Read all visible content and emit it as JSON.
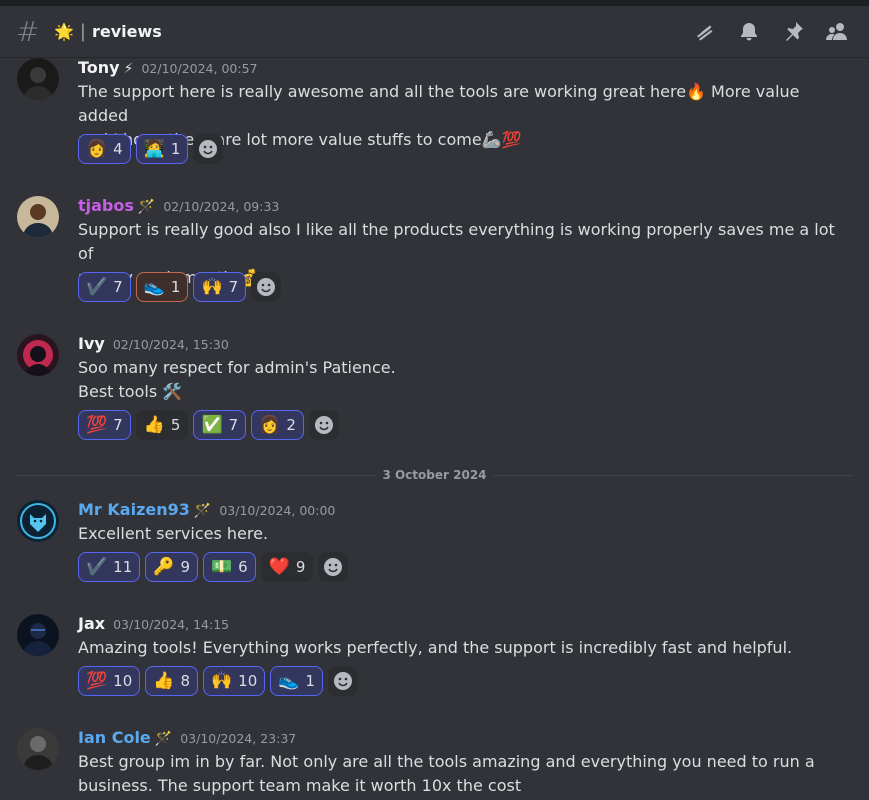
{
  "channel": {
    "emoji": "🌟",
    "separator": "|",
    "name": "reviews",
    "icons": [
      "threads-icon",
      "bell-icon",
      "pin-icon",
      "members-icon"
    ]
  },
  "messages": [
    {
      "username": "Tony",
      "badge": "⚡",
      "name_color": "#f2f3f5",
      "timestamp": "02/10/2024, 00:57",
      "lines": [
        "The support here is really awesome and all the tools are working great here🔥 More value added",
        "and I hope there are lot more value stuffs to come🦾💯"
      ],
      "reactions": [
        {
          "emoji": "👩",
          "count": "4",
          "style": "me"
        },
        {
          "emoji": "🧑‍💻",
          "count": "1",
          "style": "me"
        }
      ]
    },
    {
      "username": "tjabos",
      "badge": "🪄",
      "name_color": "#c65fe4",
      "timestamp": "02/10/2024, 09:33",
      "lines": [
        "Support is really good also I like all the products everything is working properly saves me a lot of",
        "money each month 💰"
      ],
      "reactions": [
        {
          "emoji": "✔️",
          "count": "7",
          "style": "me"
        },
        {
          "emoji": "👟",
          "count": "1",
          "style": "me-orange"
        },
        {
          "emoji": "🙌",
          "count": "7",
          "style": "me"
        }
      ]
    },
    {
      "username": "Ivy",
      "badge": "",
      "name_color": "#f2f3f5",
      "timestamp": "02/10/2024, 15:30",
      "lines": [
        "Soo many respect for admin's Patience.",
        "Best tools 🛠️"
      ],
      "reactions": [
        {
          "emoji": "💯",
          "count": "7",
          "style": "me"
        },
        {
          "emoji": "👍",
          "count": "5",
          "style": "plain"
        },
        {
          "emoji": "✅",
          "count": "7",
          "style": "me"
        },
        {
          "emoji": "👩",
          "count": "2",
          "style": "me"
        }
      ]
    },
    {
      "username": "Mr Kaizen93",
      "badge": "🪄",
      "name_color": "#5aa8f0",
      "timestamp": "03/10/2024, 00:00",
      "lines": [
        "Excellent services here."
      ],
      "reactions": [
        {
          "emoji": "✔️",
          "count": "11",
          "style": "me"
        },
        {
          "emoji": "🔑",
          "count": "9",
          "style": "me"
        },
        {
          "emoji": "💵",
          "count": "6",
          "style": "me"
        },
        {
          "emoji": "❤️",
          "count": "9",
          "style": "plain"
        }
      ]
    },
    {
      "username": "Jax",
      "badge": "",
      "name_color": "#f2f3f5",
      "timestamp": "03/10/2024, 14:15",
      "lines": [
        "Amazing tools! Everything works perfectly, and the support is incredibly fast and helpful."
      ],
      "reactions": [
        {
          "emoji": "💯",
          "count": "10",
          "style": "me"
        },
        {
          "emoji": "👍",
          "count": "8",
          "style": "me"
        },
        {
          "emoji": "🙌",
          "count": "10",
          "style": "me"
        },
        {
          "emoji": "👟",
          "count": "1",
          "style": "me"
        }
      ]
    },
    {
      "username": "Ian Cole",
      "badge": "🪄",
      "name_color": "#5aa8f0",
      "timestamp": "03/10/2024, 23:37",
      "lines": [
        "Best group im in by far. Not only are all the tools amazing and everything you need to run a",
        "business. The support team make it worth 10x the cost"
      ],
      "reactions": []
    }
  ],
  "date_divider": "3 October 2024"
}
